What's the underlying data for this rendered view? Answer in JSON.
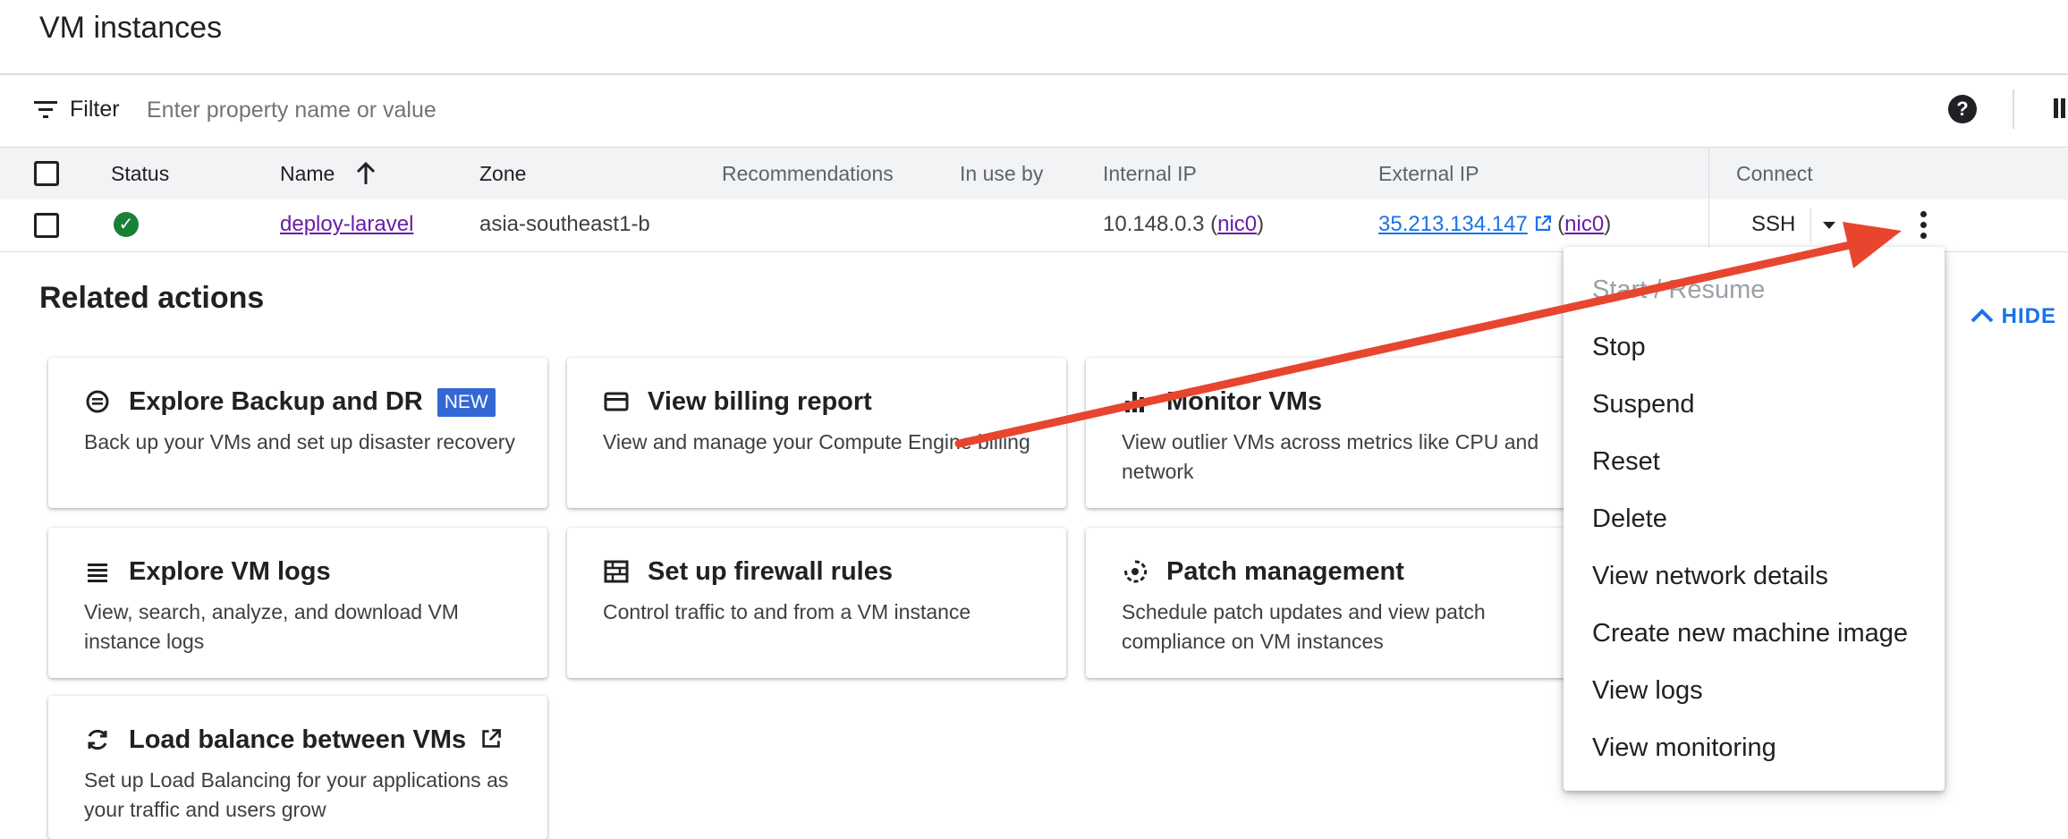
{
  "page": {
    "title": "VM instances"
  },
  "filter": {
    "label": "Filter",
    "placeholder": "Enter property name or value"
  },
  "table": {
    "headers": {
      "status": "Status",
      "name": "Name",
      "zone": "Zone",
      "recommendations": "Recommendations",
      "in_use_by": "In use by",
      "internal_ip": "Internal IP",
      "external_ip": "External IP",
      "connect": "Connect"
    },
    "rows": [
      {
        "status": "running",
        "name": "deploy-laravel",
        "zone": "asia-southeast1-b",
        "internal_ip": "10.148.0.3",
        "internal_nic": "nic0",
        "external_ip": "35.213.134.147",
        "external_nic": "nic0",
        "connect_label": "SSH"
      }
    ]
  },
  "related": {
    "title": "Related actions",
    "hide_label": "HIDE",
    "cards": [
      {
        "icon": "backup-icon",
        "title": "Explore Backup and DR",
        "badge": "NEW",
        "desc": "Back up your VMs and set up disaster recovery"
      },
      {
        "icon": "billing-card-icon",
        "title": "View billing report",
        "desc": "View and manage your Compute Engine billing"
      },
      {
        "icon": "bar-chart-icon",
        "title": "Monitor VMs",
        "desc": "View outlier VMs across metrics like CPU and network"
      },
      {
        "icon": "logs-list-icon",
        "title": "Explore VM logs",
        "desc": "View, search, analyze, and download VM instance logs"
      },
      {
        "icon": "firewall-icon",
        "title": "Set up firewall rules",
        "desc": "Control traffic to and from a VM instance"
      },
      {
        "icon": "patch-icon",
        "title": "Patch management",
        "desc": "Schedule patch updates and view patch compliance on VM instances"
      },
      {
        "icon": "load-balance-icon",
        "title": "Load balance between VMs",
        "desc": "Set up Load Balancing for your applications as your traffic and users grow"
      }
    ]
  },
  "menu": {
    "items": [
      "Start / Resume",
      "Stop",
      "Suspend",
      "Reset",
      "Delete",
      "View network details",
      "Create new machine image",
      "View logs",
      "View monitoring"
    ]
  },
  "colors": {
    "accent": "#1a73e8",
    "link_visited": "#681da8",
    "status_ok": "#188038",
    "annotation_arrow": "#e8452f",
    "badge": "#3367d6"
  }
}
